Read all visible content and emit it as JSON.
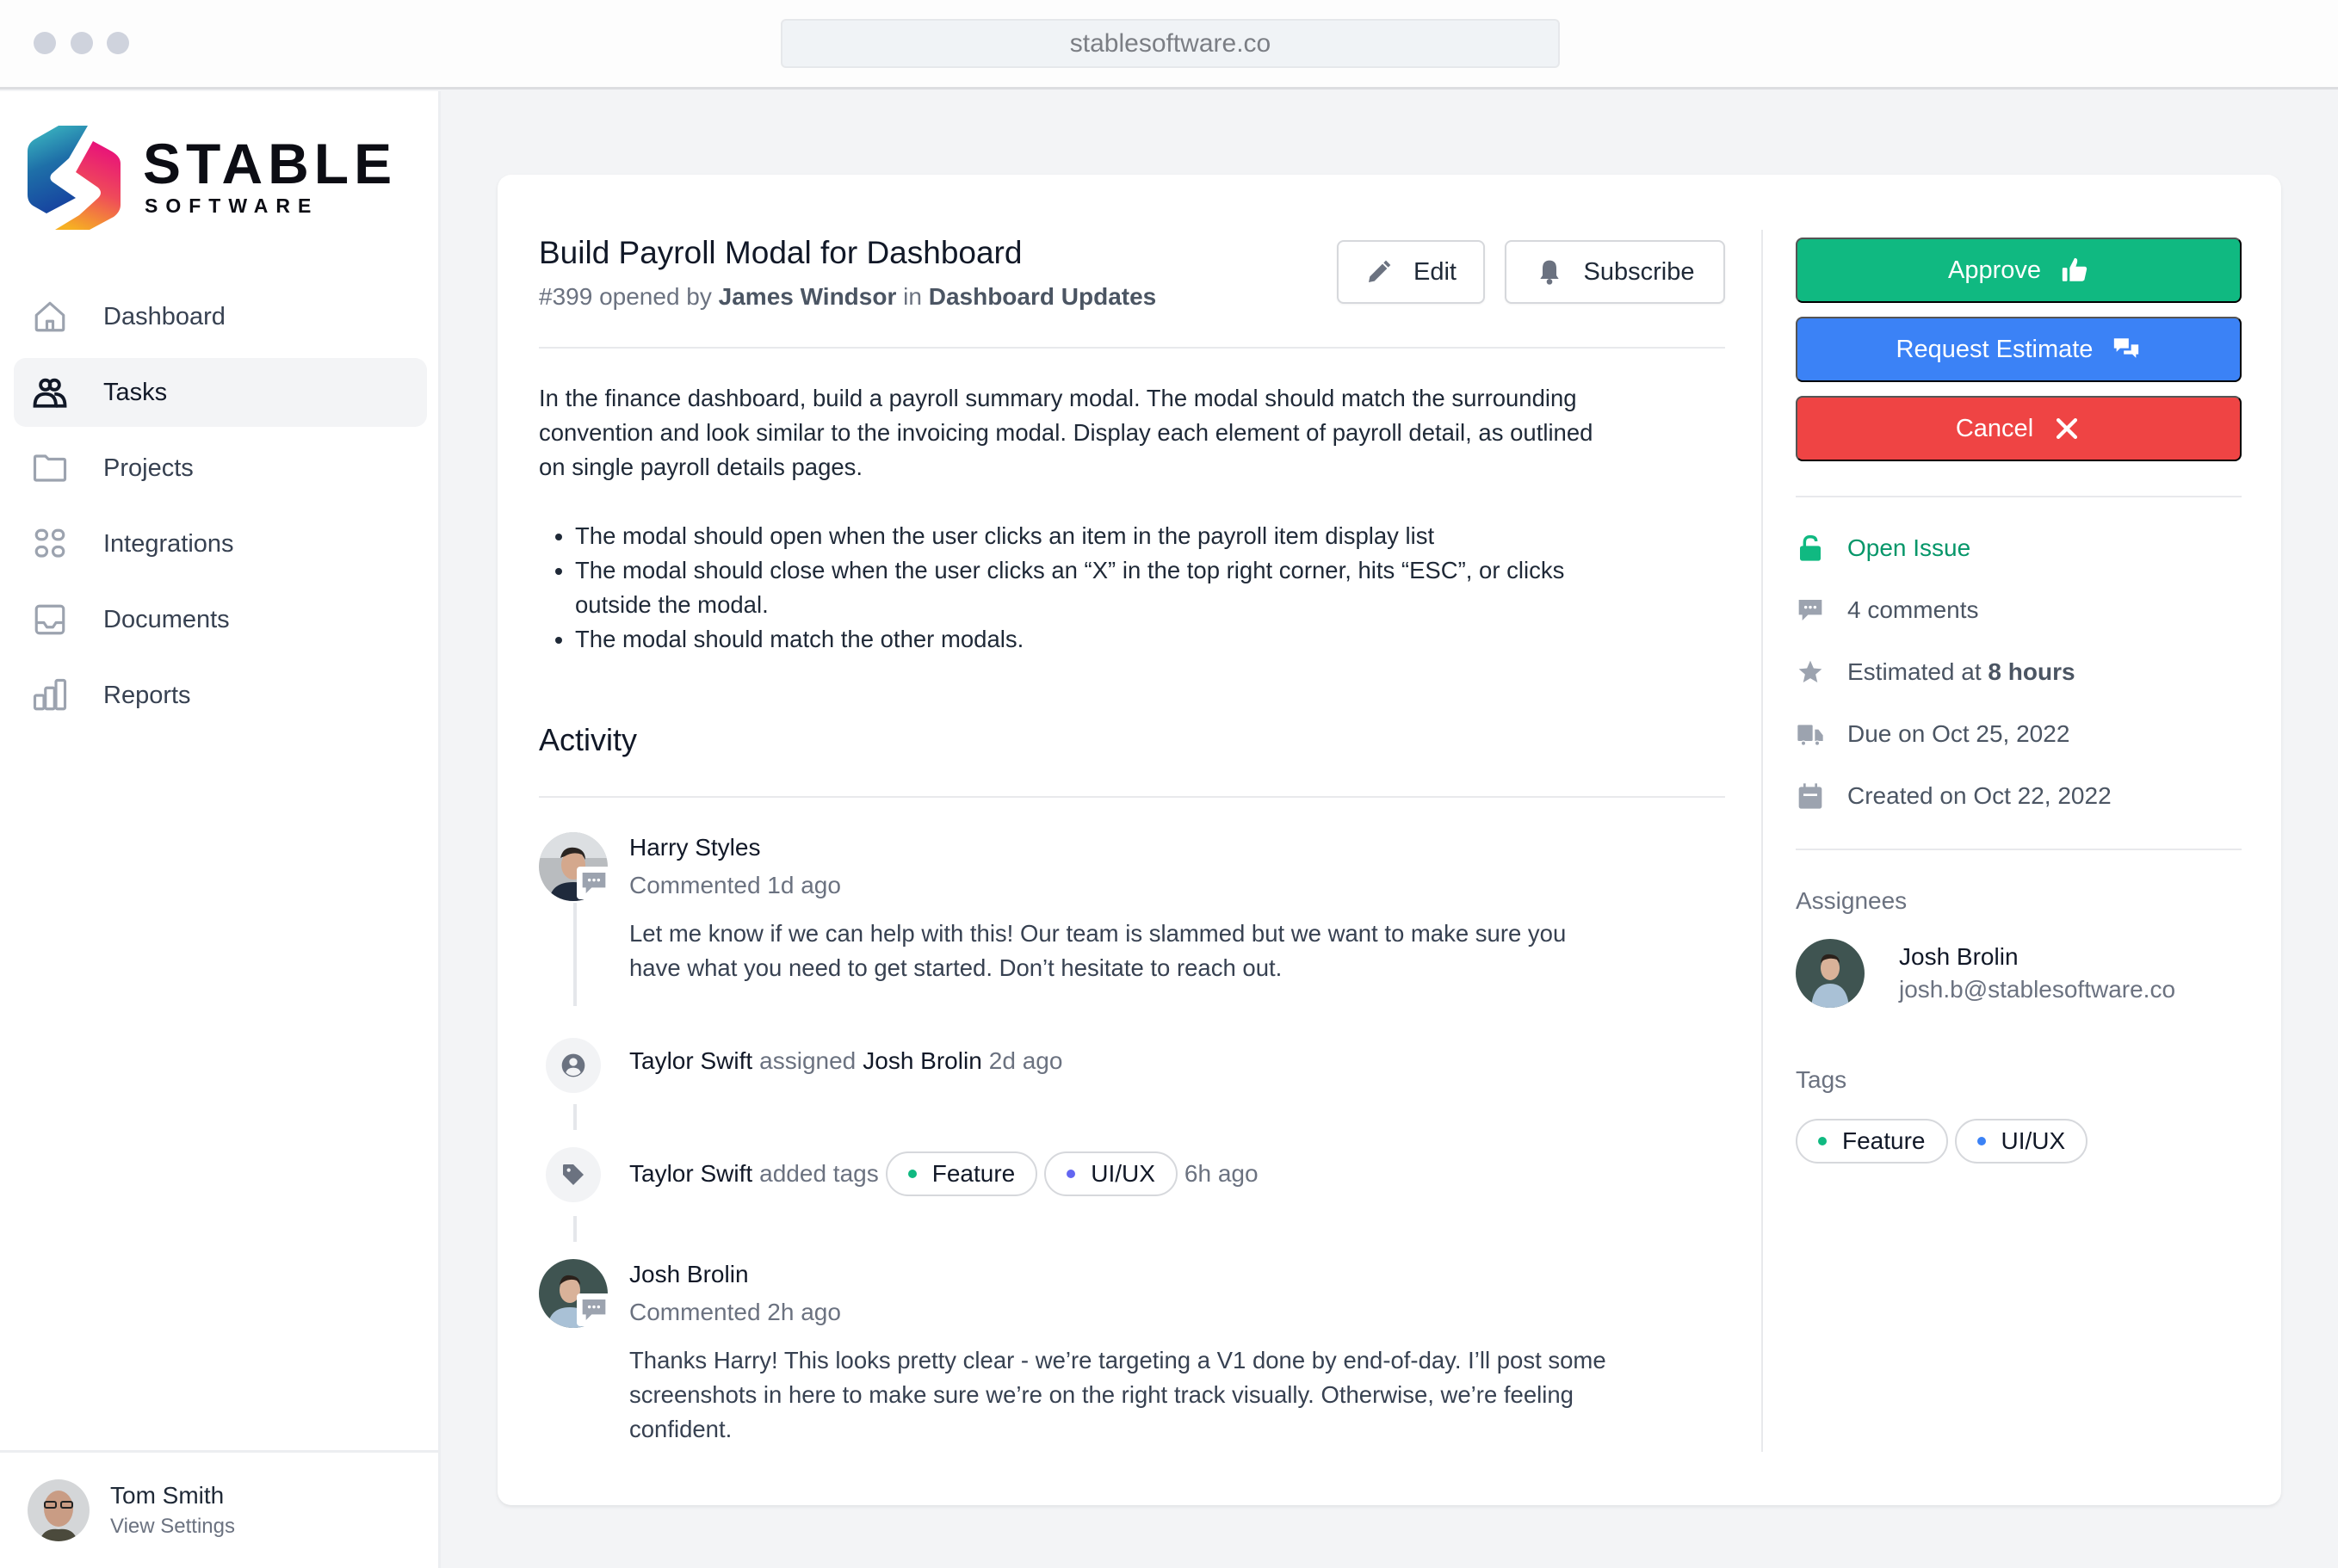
{
  "browser": {
    "url": "stablesoftware.co"
  },
  "brand": {
    "name": "STABLE",
    "sub": "SOFTWARE"
  },
  "sidebar": {
    "items": [
      {
        "label": "Dashboard",
        "icon": "home-icon",
        "active": false
      },
      {
        "label": "Tasks",
        "icon": "users-icon",
        "active": true
      },
      {
        "label": "Projects",
        "icon": "folder-icon",
        "active": false
      },
      {
        "label": "Integrations",
        "icon": "grid-icon",
        "active": false
      },
      {
        "label": "Documents",
        "icon": "inbox-icon",
        "active": false
      },
      {
        "label": "Reports",
        "icon": "bar-chart-icon",
        "active": false
      }
    ],
    "user": {
      "name": "Tom Smith",
      "link": "View Settings"
    }
  },
  "issue": {
    "title": "Build Payroll Modal for Dashboard",
    "number": "#399",
    "opened_by_text": "opened by",
    "author": "James Windsor",
    "in_text": "in",
    "project": "Dashboard Updates",
    "edit_label": "Edit",
    "subscribe_label": "Subscribe",
    "description": "In the finance dashboard, build a payroll summary modal. The modal should match the surrounding convention and look similar to the invoicing modal. Display each element of payroll detail, as outlined on single payroll details pages.",
    "bullets": [
      "The modal should open when the user clicks an item in the payroll item display list",
      "The modal should close when the user clicks an “X” in the top right corner, hits “ESC”, or clicks outside the modal.",
      "The modal should match the other modals."
    ]
  },
  "activity": {
    "title": "Activity",
    "items": [
      {
        "type": "comment",
        "name": "Harry Styles",
        "meta": "Commented 1d ago",
        "body": "Let me know if we can help with this! Our team is slammed but we want to make sure you have what you need to get started. Don’t hesitate to reach out."
      },
      {
        "type": "assign",
        "actor": "Taylor Swift",
        "verb": "assigned",
        "target": "Josh Brolin",
        "time": "2d ago"
      },
      {
        "type": "tags",
        "actor": "Taylor Swift",
        "verb": "added tags",
        "tags": [
          {
            "label": "Feature",
            "color": "#10b981"
          },
          {
            "label": "UI/UX",
            "color": "#6366f1"
          }
        ],
        "time": "6h ago"
      },
      {
        "type": "comment",
        "name": "Josh Brolin",
        "meta": "Commented 2h ago",
        "body": "Thanks Harry! This looks pretty clear - we’re targeting a V1 done by end-of-day. I’ll post some screenshots in here to make sure we’re on the right track visually. Otherwise, we’re feeling confident."
      }
    ]
  },
  "actions": {
    "approve": {
      "label": "Approve",
      "color": "#10b981"
    },
    "request_estimate": {
      "label": "Request Estimate",
      "color": "#3b82f6"
    },
    "cancel": {
      "label": "Cancel",
      "color": "#ef4444"
    }
  },
  "meta": {
    "status": "Open Issue",
    "status_color": "#059669",
    "comments": "4 comments",
    "estimate_prefix": "Estimated at",
    "estimate_value": "8 hours",
    "due": "Due on Oct 25, 2022",
    "created": "Created on Oct 22, 2022"
  },
  "assignees": {
    "label": "Assignees",
    "items": [
      {
        "name": "Josh Brolin",
        "email": "josh.b@stablesoftware.co"
      }
    ]
  },
  "tags": {
    "label": "Tags",
    "items": [
      {
        "label": "Feature",
        "color": "#10b981"
      },
      {
        "label": "UI/UX",
        "color": "#3b82f6"
      }
    ]
  }
}
